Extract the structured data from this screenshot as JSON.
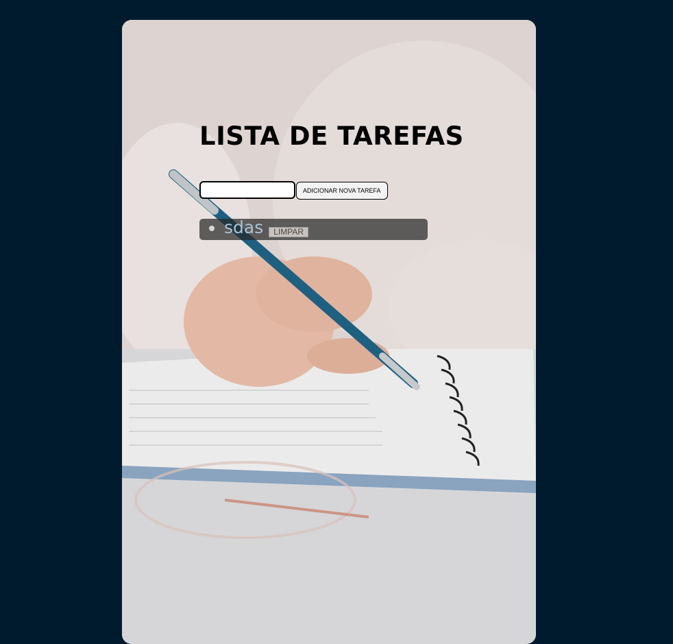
{
  "page": {
    "background_color": "#001b2e",
    "title": "LISTA DE TAREFAS"
  },
  "form": {
    "input_value": "",
    "input_placeholder": "",
    "add_button_label": "ADICIONAR NOVA TAREFA"
  },
  "tasks": [
    {
      "text": "sdas",
      "clear_label": "LIMPAR"
    }
  ],
  "background_image": {
    "icon": "writing-photo"
  }
}
